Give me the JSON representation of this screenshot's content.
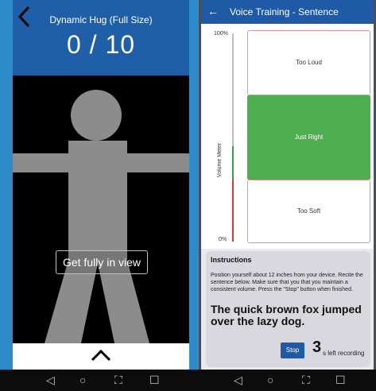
{
  "left_phone": {
    "title": "Dynamic Hug (Full Size)",
    "counter": "0 / 10",
    "hint": "Get fully in view",
    "icons": {
      "back": "back-chevron-icon",
      "expand": "chevron-up-icon"
    },
    "colors": {
      "frame": "#2c8ccc",
      "header": "#1f5fa8",
      "figure": "#8c8c8c"
    }
  },
  "right_phone": {
    "title": "Voice Training - Sentence",
    "meter": {
      "label": "Volume Meter",
      "top": "100%",
      "bottom": "0%",
      "zones": {
        "loud": "Too Loud",
        "right": "Just Right",
        "soft": "Too Soft"
      },
      "colors": {
        "just_right": "#4daf50",
        "too_soft": "#d23a3a",
        "border": "#e39393"
      }
    },
    "instructions": {
      "title": "Instructions",
      "text": "Position yourself about 12 inches from your device. Recite the sentence below. Make sure that you that you maintain a consistent volume. Press the \"Stop\" button when finished.",
      "sentence": "The quick brown fox jumped over the lazy dog.",
      "stop_label": "Stop",
      "seconds": "3",
      "seconds_suffix": "s left recording"
    }
  },
  "nav": {
    "back": "◁",
    "home": "○",
    "recents": "⛶",
    "square": "☐"
  }
}
